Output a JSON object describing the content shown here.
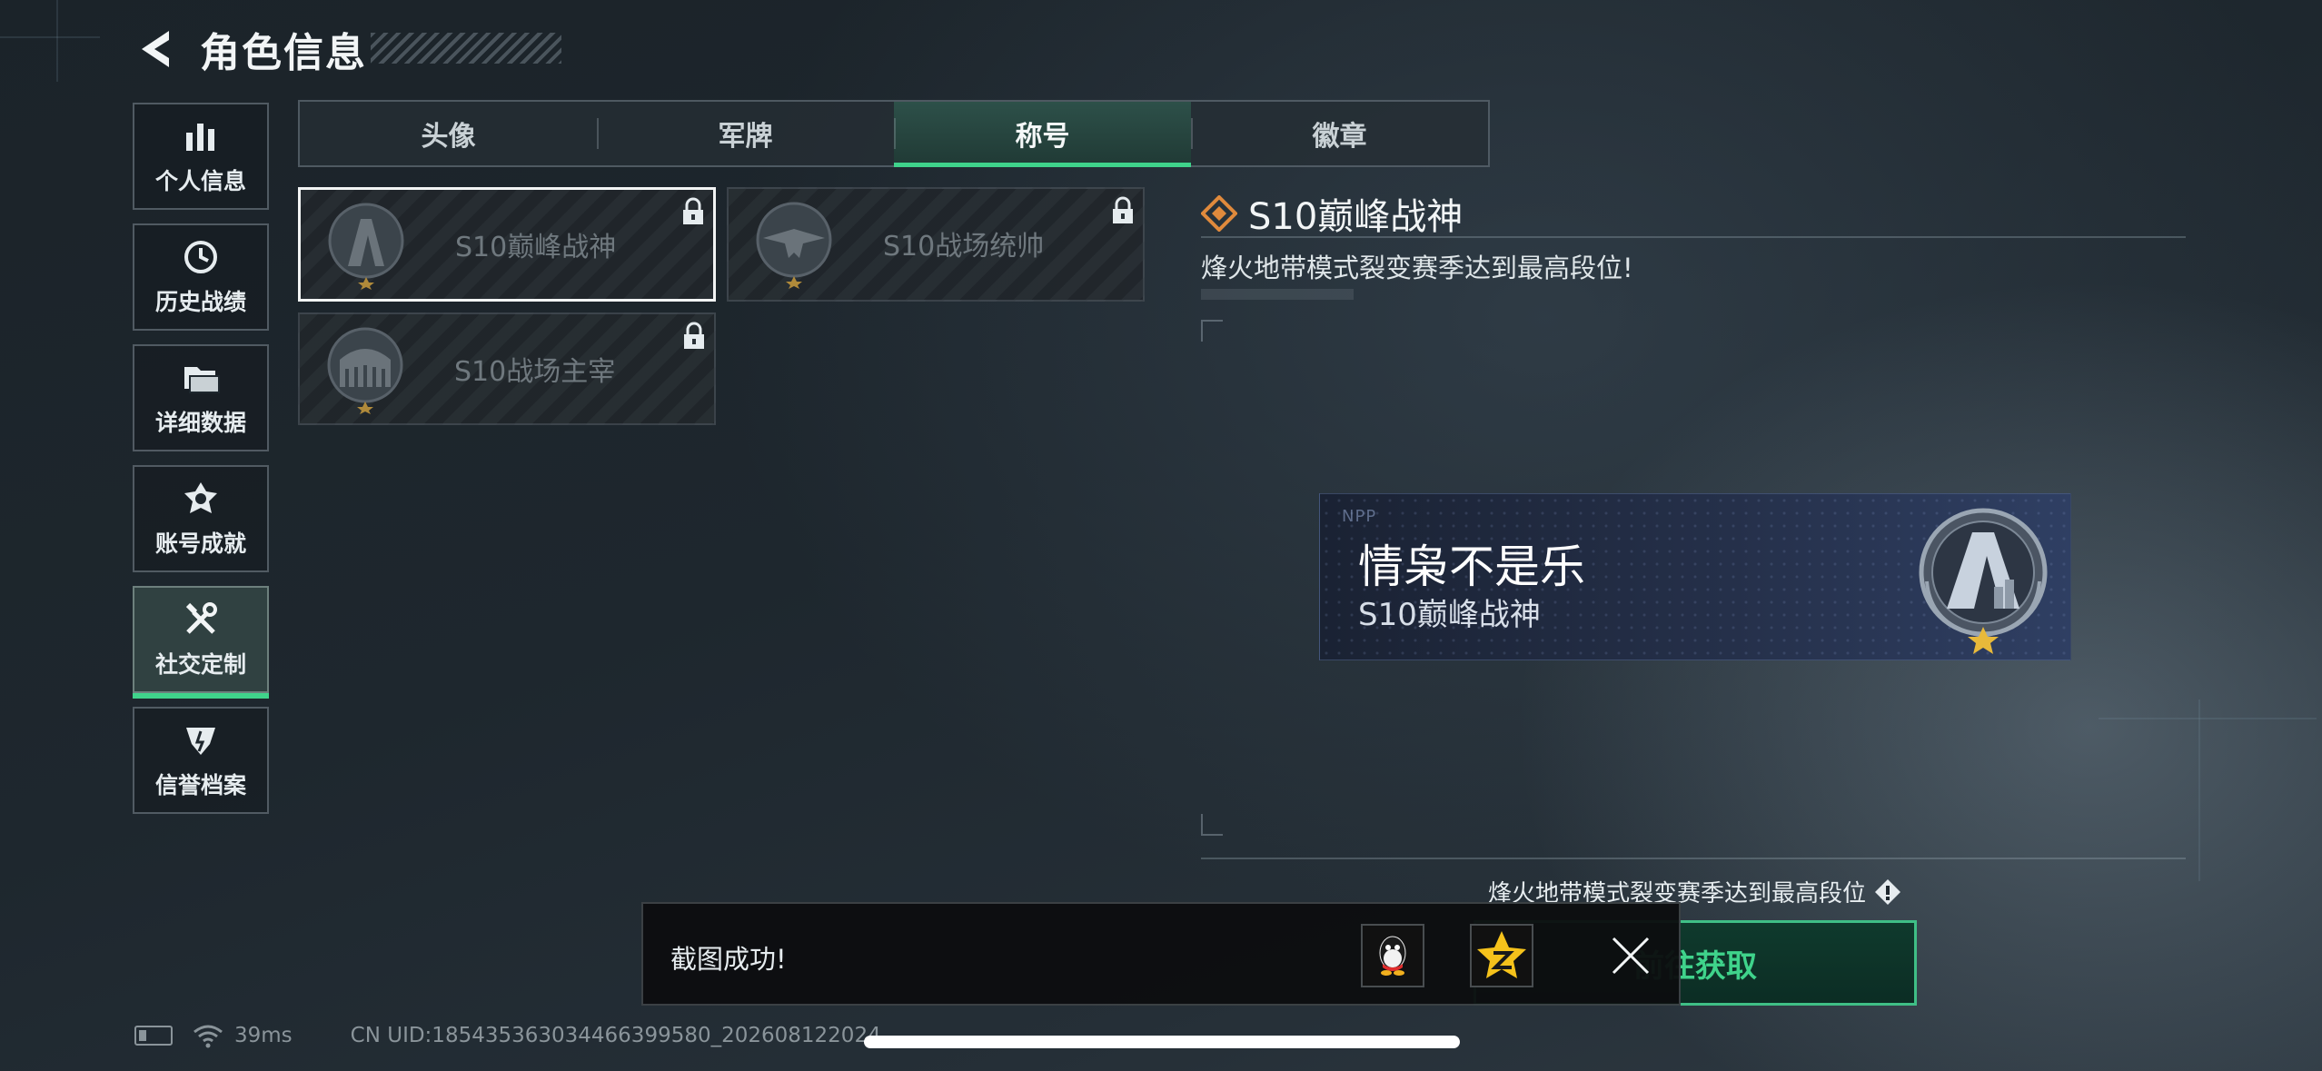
{
  "header": {
    "title": "角色信息"
  },
  "sidebar": {
    "items": [
      {
        "label": "个人信息",
        "icon": "bar-chart-icon"
      },
      {
        "label": "历史战绩",
        "icon": "clock-icon"
      },
      {
        "label": "详细数据",
        "icon": "folder-icon"
      },
      {
        "label": "账号成就",
        "icon": "medal-icon"
      },
      {
        "label": "社交定制",
        "icon": "tools-icon",
        "active": true
      },
      {
        "label": "信誉档案",
        "icon": "shield-badge-icon"
      }
    ]
  },
  "tabs": [
    {
      "label": "头像"
    },
    {
      "label": "军牌"
    },
    {
      "label": "称号",
      "active": true
    },
    {
      "label": "徽章"
    }
  ],
  "titles": [
    {
      "name": "S10巅峰战神",
      "locked": true,
      "selected": true
    },
    {
      "name": "S10战场统帅",
      "locked": true
    },
    {
      "name": "S10战场主宰",
      "locked": true
    }
  ],
  "detail": {
    "title": "S10巅峰战神",
    "description": "烽火地带模式裂变赛季达到最高段位!",
    "nameplate": {
      "mark": "NPP",
      "player_name": "情枭不是乐",
      "title": "S10巅峰战神"
    },
    "requirement": "烽火地带模式裂变赛季达到最高段位",
    "action_button": "前往获取"
  },
  "toast": {
    "message": "截图成功!"
  },
  "status_bar": {
    "ping": "39ms",
    "uid": "CN UID:185435363034466399580_202608122024"
  },
  "colors": {
    "accent": "#3fd38b",
    "background": "#1e272e",
    "gem": "#e08a3c"
  }
}
